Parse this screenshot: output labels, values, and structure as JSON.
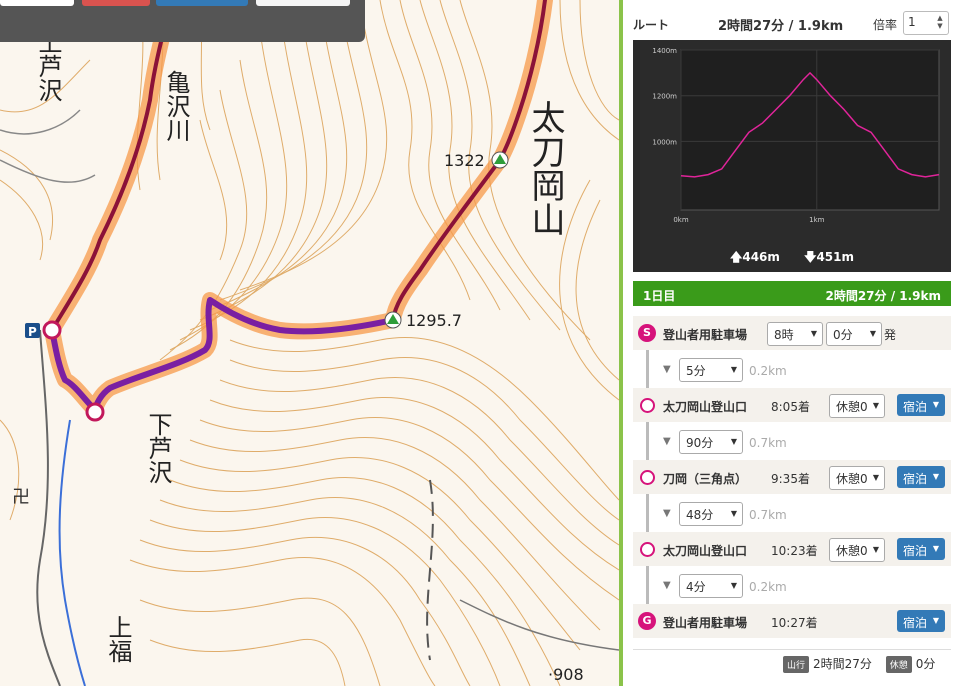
{
  "map": {
    "labels": {
      "kami_ashizawa": "上芦沢",
      "kamesawagawa": "亀沢川",
      "tachiokayama": "太刀岡山",
      "shimo_ashizawa": "下芦沢",
      "kami_fuku": "上福",
      "summit_1322": "1322",
      "summit_1295": "1295.7",
      "point_908": "·908",
      "parking": "P",
      "temple": "卍"
    },
    "route_color": "#7a1fa2",
    "route_outline_color": "#f79a4a"
  },
  "panel": {
    "route_label": "ルート",
    "route_summary": "2時間27分 / 1.9km",
    "zoom_label": "倍率",
    "zoom_value": "1",
    "elevation": {
      "ascent": "446m",
      "descent": "451m"
    },
    "day": {
      "label": "1日目",
      "summary": "2時間27分 / 1.9km"
    },
    "schedule": {
      "start": {
        "marker": "S",
        "name": "登山者用駐車場",
        "hour": "8時",
        "minute": "0分",
        "suffix": "発"
      },
      "leg1": {
        "duration": "5分",
        "distance": "0.2km"
      },
      "stop1": {
        "name": "太刀岡山登山口",
        "arrive": "8:05着",
        "rest": "休憩0",
        "lodge": "宿泊"
      },
      "leg2": {
        "duration": "90分",
        "distance": "0.7km"
      },
      "stop2": {
        "name": "刀岡（三角点）",
        "arrive": "9:35着",
        "rest": "休憩0",
        "lodge": "宿泊"
      },
      "leg3": {
        "duration": "48分",
        "distance": "0.7km"
      },
      "stop3": {
        "name": "太刀岡山登山口",
        "arrive": "10:23着",
        "rest": "休憩0",
        "lodge": "宿泊"
      },
      "leg4": {
        "duration": "4分",
        "distance": "0.2km"
      },
      "goal": {
        "marker": "G",
        "name": "登山者用駐車場",
        "arrive": "10:27着",
        "lodge": "宿泊"
      }
    },
    "footer": {
      "walk_badge": "山行",
      "walk_time": "2時間27分",
      "rest_badge": "休憩",
      "rest_time": "0分"
    }
  },
  "chart_data": {
    "type": "area",
    "title": "",
    "xlabel": "",
    "ylabel": "",
    "x_unit": "km",
    "y_unit": "m",
    "xlim": [
      0,
      1.9
    ],
    "ylim": [
      700,
      1400
    ],
    "yticks": [
      "1400m",
      "1200m",
      "1000m"
    ],
    "xticks": [
      "0km",
      "1km"
    ],
    "line_color": "#e0249a",
    "series": [
      {
        "x": [
          0,
          0.1,
          0.2,
          0.3,
          0.4,
          0.5,
          0.6,
          0.7,
          0.8,
          0.9,
          0.95,
          1.0,
          1.1,
          1.2,
          1.3,
          1.4,
          1.5,
          1.6,
          1.7,
          1.8,
          1.9
        ],
        "y": [
          850,
          845,
          855,
          880,
          960,
          1040,
          1080,
          1140,
          1200,
          1270,
          1300,
          1270,
          1200,
          1140,
          1070,
          1040,
          960,
          880,
          855,
          845,
          855
        ]
      }
    ]
  }
}
